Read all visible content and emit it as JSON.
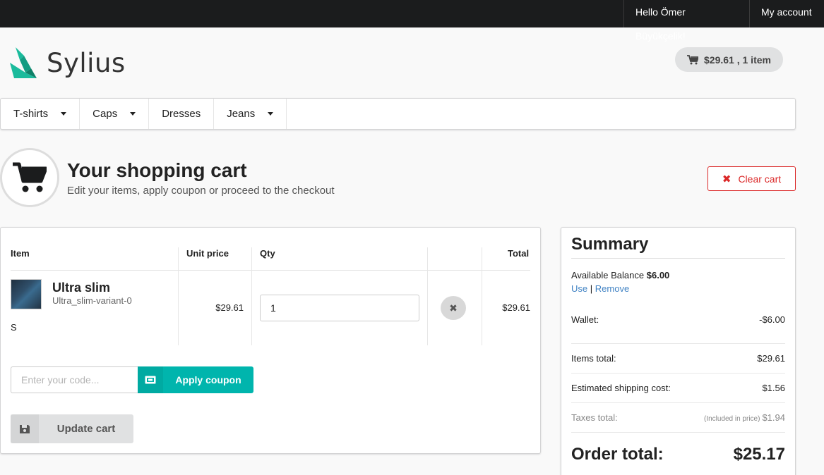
{
  "topbar": {
    "greeting": "Hello Ömer Büyükçelik!",
    "account": "My account"
  },
  "brand": {
    "name": "Sylius",
    "color": "#1abb9c"
  },
  "header_cart": {
    "label": "$29.61 , 1 item"
  },
  "menu": [
    {
      "label": "T-shirts",
      "has_dropdown": true
    },
    {
      "label": "Caps",
      "has_dropdown": true
    },
    {
      "label": "Dresses",
      "has_dropdown": false
    },
    {
      "label": "Jeans",
      "has_dropdown": true
    }
  ],
  "page": {
    "title": "Your shopping cart",
    "subtitle": "Edit your items, apply coupon or proceed to the checkout",
    "clear_cart": "Clear cart"
  },
  "table": {
    "headers": {
      "item": "Item",
      "unit_price": "Unit price",
      "qty": "Qty",
      "total": "Total"
    },
    "rows": [
      {
        "name": "Ultra slim",
        "variant": "Ultra_slim-variant-0",
        "size": "S",
        "unit_price": "$29.61",
        "qty": "1",
        "total": "$29.61"
      }
    ]
  },
  "coupon": {
    "placeholder": "Enter your code...",
    "apply_label": "Apply coupon"
  },
  "update_label": "Update cart",
  "summary": {
    "title": "Summary",
    "balance_label": "Available Balance",
    "balance_value": "$6.00",
    "use": "Use",
    "separator": "|",
    "remove": "Remove",
    "wallet_label": "Wallet:",
    "wallet_value": "-$6.00",
    "items_total_label": "Items total:",
    "items_total_value": "$29.61",
    "shipping_label": "Estimated shipping cost:",
    "shipping_value": "$1.56",
    "taxes_label": "Taxes total:",
    "taxes_note": "(Included in price)",
    "taxes_value": "$1.94",
    "order_total_label": "Order total:",
    "order_total_value": "$25.17"
  },
  "colors": {
    "accent_teal": "#00b5ad",
    "danger": "#db2828",
    "link": "#4183c4",
    "topbar": "#1b1c1d"
  }
}
